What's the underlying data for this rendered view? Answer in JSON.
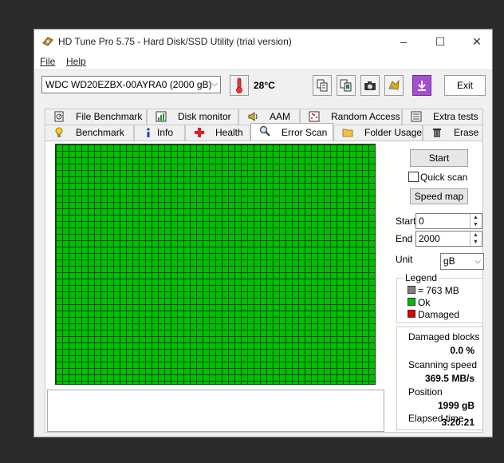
{
  "window": {
    "title": "HD Tune Pro 5.75 - Hard Disk/SSD Utility (trial version)",
    "controls": {
      "minimize": "–",
      "maximize": "☐",
      "close": "✕"
    }
  },
  "menu": {
    "items": [
      "File",
      "Help"
    ]
  },
  "toolbar": {
    "drive": "WDC WD20EZBX-00AYRA0 (2000 gB)",
    "temperature": "28°C",
    "exit_label": "Exit",
    "buttons": [
      "copy-icon",
      "copy-all-icon",
      "screenshot-icon",
      "options-icon",
      "save-icon"
    ]
  },
  "tabs": {
    "row1": [
      "File Benchmark",
      "Disk monitor",
      "AAM",
      "Random Access",
      "Extra tests"
    ],
    "row2": [
      "Benchmark",
      "Info",
      "Health",
      "Error Scan",
      "Folder Usage",
      "Erase"
    ],
    "active": "Error Scan"
  },
  "error_scan": {
    "start_label": "Start",
    "quick_scan_label": "Quick scan",
    "quick_scan_checked": false,
    "speed_map_label": "Speed map",
    "start_field_label": "Start",
    "start_value": "0",
    "end_field_label": "End",
    "end_value": "2000",
    "unit_label": "Unit",
    "unit_value": "gB",
    "legend": {
      "title": "Legend",
      "block_size": "= 763 MB",
      "ok": "Ok",
      "damaged": "Damaged"
    },
    "stats": {
      "damaged_blocks_label": "Damaged blocks",
      "damaged_blocks_value": "0.0 %",
      "scanning_speed_label": "Scanning speed",
      "scanning_speed_value": "369.5 MB/s",
      "position_label": "Position",
      "position_value": "1999 gB",
      "elapsed_label": "Elapsed time",
      "elapsed_value": "3:20:21"
    }
  },
  "colors": {
    "ok_block": "#00c000",
    "grid_line": "#0a4a0a",
    "damaged": "#e00000",
    "block_gray": "#808080"
  }
}
